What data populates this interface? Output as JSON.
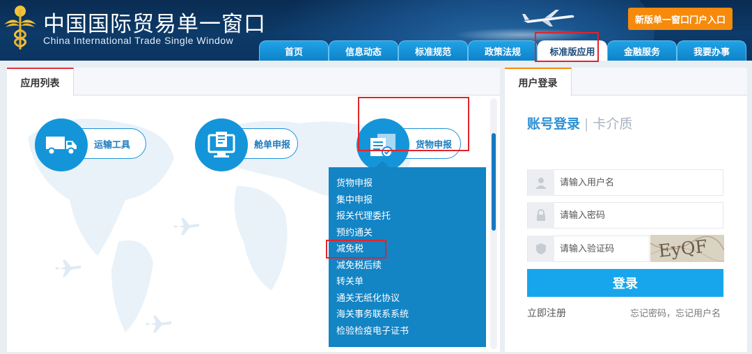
{
  "header": {
    "title_cn": "中国国际贸易单一窗口",
    "title_en": "China International Trade Single Window",
    "logo_icon": "customs-emblem-icon",
    "portal_button": "新版单一窗口门户入口",
    "nav_tabs": [
      {
        "label": "首页"
      },
      {
        "label": "信息动态"
      },
      {
        "label": "标准规范"
      },
      {
        "label": "政策法规"
      },
      {
        "label": "标准版应用",
        "active": true
      },
      {
        "label": "金融服务"
      },
      {
        "label": "我要办事"
      }
    ]
  },
  "app_panel": {
    "tab_label": "应用列表",
    "apps": [
      {
        "label": "运输工具",
        "icon": "truck-icon"
      },
      {
        "label": "舱单申报",
        "icon": "computer-document-icon"
      },
      {
        "label": "货物申报",
        "icon": "cargo-box-icon"
      }
    ],
    "dropdown": [
      "货物申报",
      "集中申报",
      "报关代理委托",
      "预约通关",
      "减免税",
      "减免税后续",
      "转关单",
      "通关无纸化协议",
      "海关事务联系系统",
      "检验检疫电子证书"
    ]
  },
  "login_panel": {
    "tab_label": "用户登录",
    "mode_active": "账号登录",
    "mode_separator": "|",
    "mode_other": "卡介质",
    "username_placeholder": "请输入用户名",
    "password_placeholder": "请输入密码",
    "captcha_placeholder": "请输入验证码",
    "captcha_text": "EyQF",
    "login_button": "登录",
    "register_link": "立即注册",
    "forgot_link": "忘记密码，忘记用户名"
  },
  "colors": {
    "accent_blue": "#1495da",
    "highlight_red": "#e0242c",
    "portal_orange": "#f58a0b",
    "header_navy": "#0d3a68"
  }
}
